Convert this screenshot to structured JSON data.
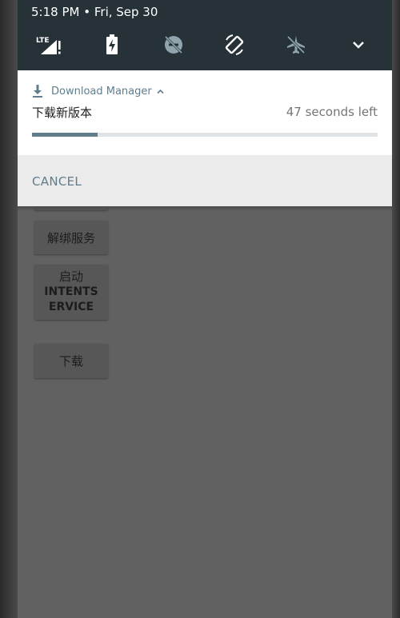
{
  "status_bar": {
    "time": "5:18 PM",
    "date": "Fri, Sep 30"
  },
  "quick_settings": {
    "icons": [
      "lte-signal-icon",
      "battery-charging-icon",
      "do-not-disturb-off-icon",
      "auto-rotate-icon",
      "airplane-mode-icon",
      "chevron-down-icon"
    ],
    "lte_label": "LTE"
  },
  "notification": {
    "app_name": "Download Manager",
    "title": "下载新版本",
    "time_left": "47 seconds left",
    "progress": 0.19,
    "action_cancel": "CANCEL"
  },
  "app": {
    "btn_unbind": "解绑服务",
    "btn_intent_line1": "启动",
    "btn_intent_line2": "INTENTS",
    "btn_intent_line3": "ERVICE",
    "btn_download": "下载"
  },
  "colors": {
    "header_bg": "#263238",
    "accent": "#607d8b",
    "scrim_bg": "#616161"
  }
}
